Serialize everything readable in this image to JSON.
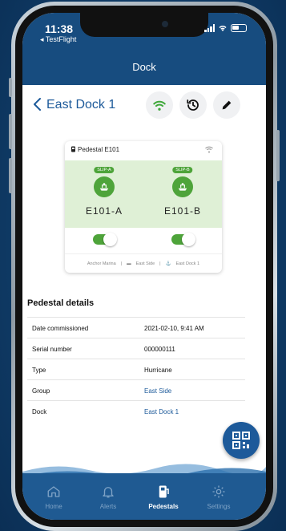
{
  "status": {
    "time": "11:38",
    "back_app": "◂ TestFlight"
  },
  "nav": {
    "title": "Dock"
  },
  "page": {
    "back_title": "East Dock 1"
  },
  "pedestal": {
    "name": "Pedestal E101",
    "slips": [
      {
        "tag": "SLIP-A",
        "label": "E101-A",
        "powered": true
      },
      {
        "tag": "SLIP-B",
        "label": "E101-B",
        "powered": true
      }
    ],
    "breadcrumb": {
      "marina": "Anchor Marina",
      "group": "East Side",
      "dock": "East Dock 1"
    }
  },
  "details": {
    "title": "Pedestal details",
    "rows": [
      {
        "label": "Date commissioned",
        "value": "2021-02-10, 9:41 AM"
      },
      {
        "label": "Serial number",
        "value": "000000111"
      },
      {
        "label": "Type",
        "value": "Hurricane"
      },
      {
        "label": "Group",
        "value": "East Side"
      },
      {
        "label": "Dock",
        "value": "East Dock 1"
      }
    ]
  },
  "tabs": [
    {
      "label": "Home",
      "icon": "home-icon"
    },
    {
      "label": "Alerts",
      "icon": "bell-icon"
    },
    {
      "label": "Pedestals",
      "icon": "pedestal-icon"
    },
    {
      "label": "Settings",
      "icon": "gear-icon"
    }
  ],
  "colors": {
    "header": "#174c7f",
    "accent": "#1d5a9a",
    "green": "#4ea43a",
    "tabbar": "#1f5a92"
  }
}
